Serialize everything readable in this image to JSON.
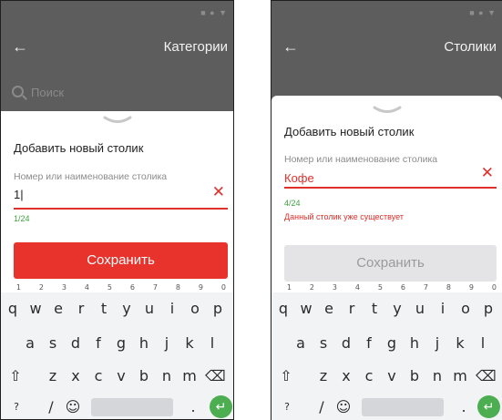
{
  "status_icons": "■ ● ▼",
  "left": {
    "toolbar_back": "←",
    "toolbar_title": "Категории",
    "search_placeholder": "Поиск",
    "sheet_title": "Добавить новый столик",
    "field_label": "Номер или наименование столика",
    "field_value": "1|",
    "counter": "1/24",
    "save_label": "Сохранить"
  },
  "right": {
    "toolbar_back": "←",
    "toolbar_title": "Столики",
    "sheet_title": "Добавить новый столик",
    "field_label": "Номер или наименование столика",
    "field_value": "Кофе",
    "counter": "4/24",
    "error": "Данный столик уже существует",
    "save_label": "Сохранить"
  },
  "keyboard": {
    "row1": [
      "q",
      "w",
      "e",
      "r",
      "t",
      "y",
      "u",
      "i",
      "o",
      "p"
    ],
    "row1_hints": [
      "1",
      "2",
      "3",
      "4",
      "5",
      "6",
      "7",
      "8",
      "9",
      "0"
    ],
    "row2": [
      "a",
      "s",
      "d",
      "f",
      "g",
      "h",
      "j",
      "k",
      "l"
    ],
    "row3": [
      "z",
      "x",
      "c",
      "v",
      "b",
      "n",
      "m"
    ],
    "shift": "⇧",
    "backspace": "⌫",
    "symbols": "?123",
    "slash": "/",
    "emoji": "☺",
    "period": ".",
    "enter": "↵"
  },
  "colors": {
    "accent": "#e8332d",
    "ok": "#3ea33e",
    "enter_key": "#4cae50"
  }
}
